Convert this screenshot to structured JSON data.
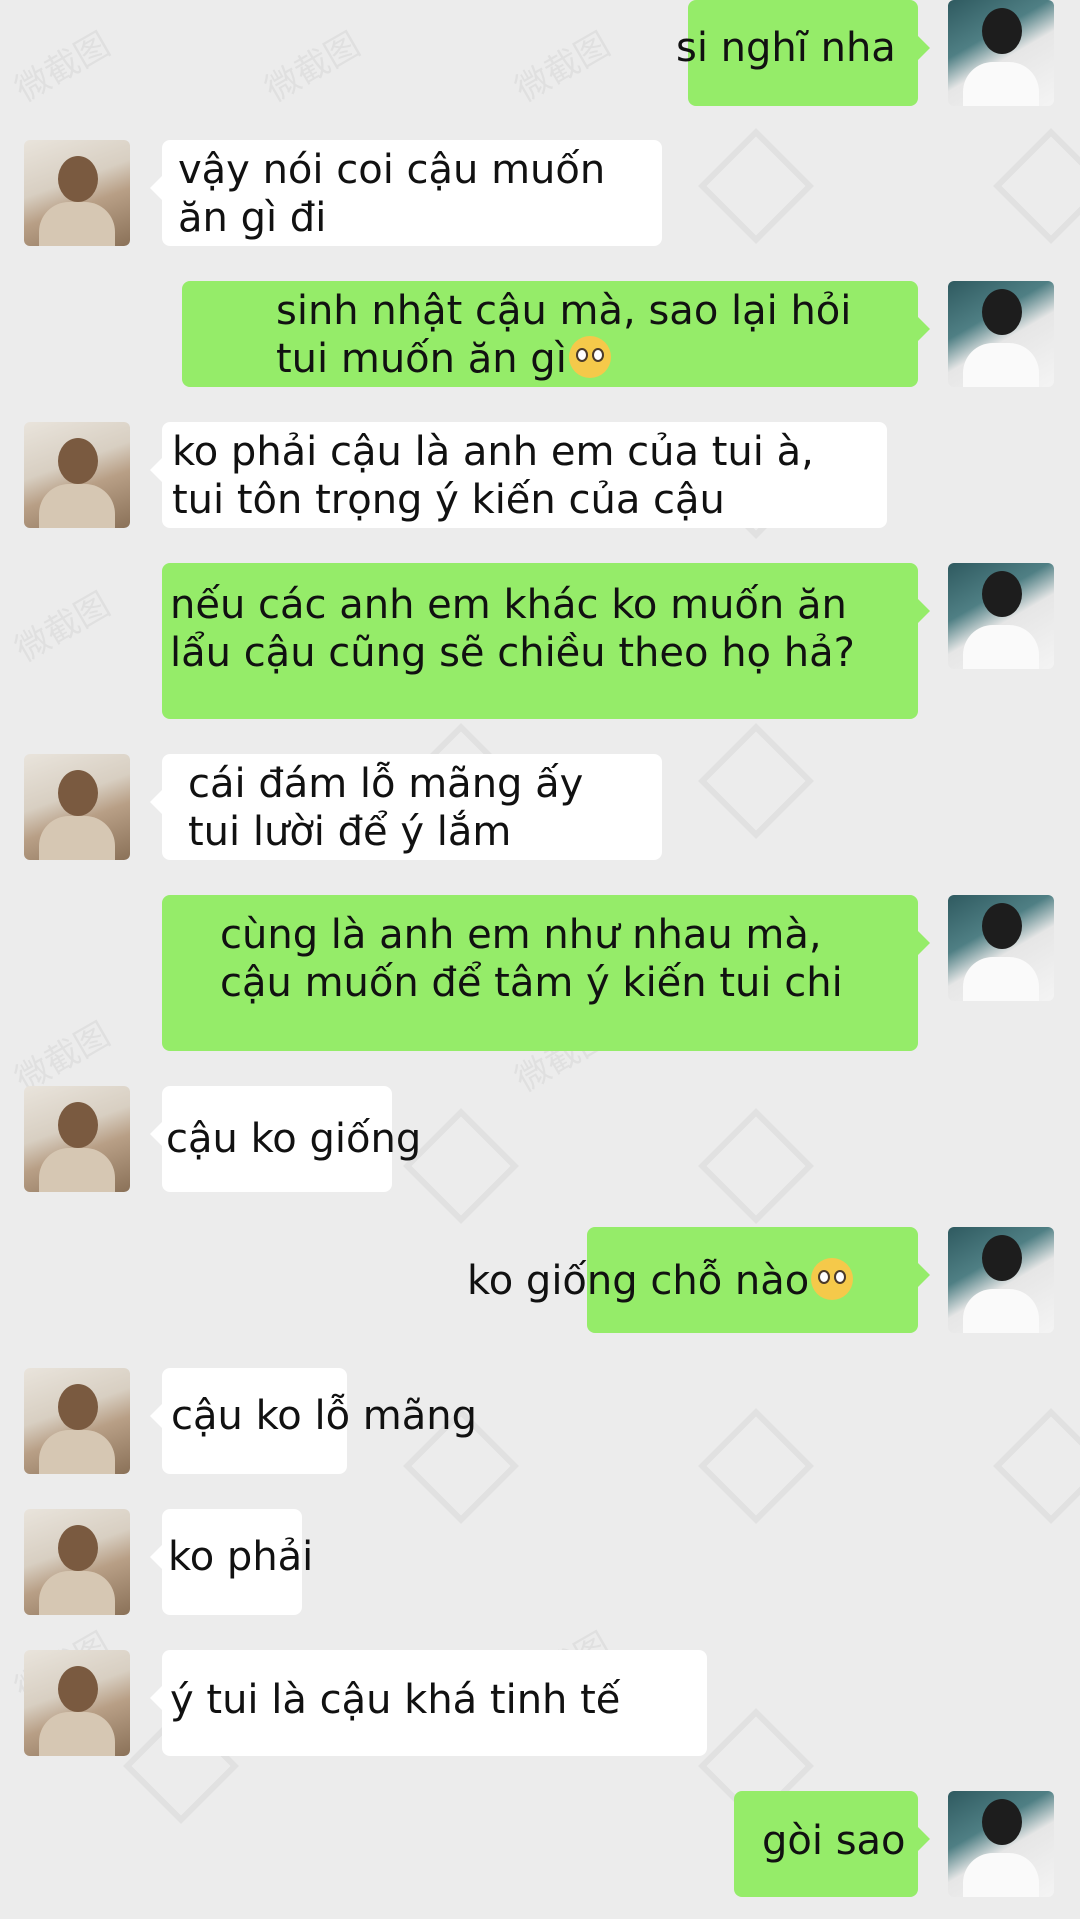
{
  "colors": {
    "background": "#ececec",
    "incoming_bubble": "#ffffff",
    "outgoing_bubble": "#95ec69"
  },
  "watermark": {
    "text": "微截图"
  },
  "messages": [
    {
      "side": "right",
      "text": "si nghĩ nha"
    },
    {
      "side": "left",
      "text": "vậy nói coi cậu muốn\năn gì đi"
    },
    {
      "side": "right",
      "text": "sinh nhật cậu mà, sao lại hỏi\ntui muốn ăn gì",
      "emoji": "pleading-face"
    },
    {
      "side": "left",
      "text": "ko phải cậu là anh em của tui à,\ntui tôn trọng ý kiến của cậu"
    },
    {
      "side": "right",
      "text": "nếu các anh em khác ko muốn ăn\nlẩu cậu cũng sẽ chiều theo họ hả?"
    },
    {
      "side": "left",
      "text": "cái đám lỗ mãng ấy\ntui lười để ý lắm"
    },
    {
      "side": "right",
      "text": "cùng là anh em như nhau mà,\ncậu muốn để tâm ý kiến tui chi"
    },
    {
      "side": "left",
      "text": "cậu ko giống"
    },
    {
      "side": "right",
      "text": "ko giống chỗ nào",
      "emoji": "pleading-face"
    },
    {
      "side": "left",
      "text": "cậu ko lỗ mãng"
    },
    {
      "side": "left",
      "text": "ko phải"
    },
    {
      "side": "left",
      "text": "ý tui là cậu khá tinh tế"
    },
    {
      "side": "right",
      "text": "gòi sao"
    }
  ]
}
